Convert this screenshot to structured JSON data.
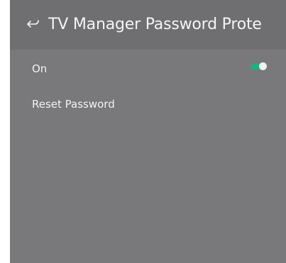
{
  "header": {
    "title": "TV Manager Password Prote",
    "back_icon": "back-arrow-icon"
  },
  "settings": {
    "on_label": "On",
    "on_toggle_state": true,
    "reset_password_label": "Reset Password"
  },
  "colors": {
    "panel_background": "#79797b",
    "header_background": "#6f6f71",
    "toggle_on": "#19b37a",
    "toggle_knob": "#f0f0f0",
    "text": "#f2f2f2"
  }
}
